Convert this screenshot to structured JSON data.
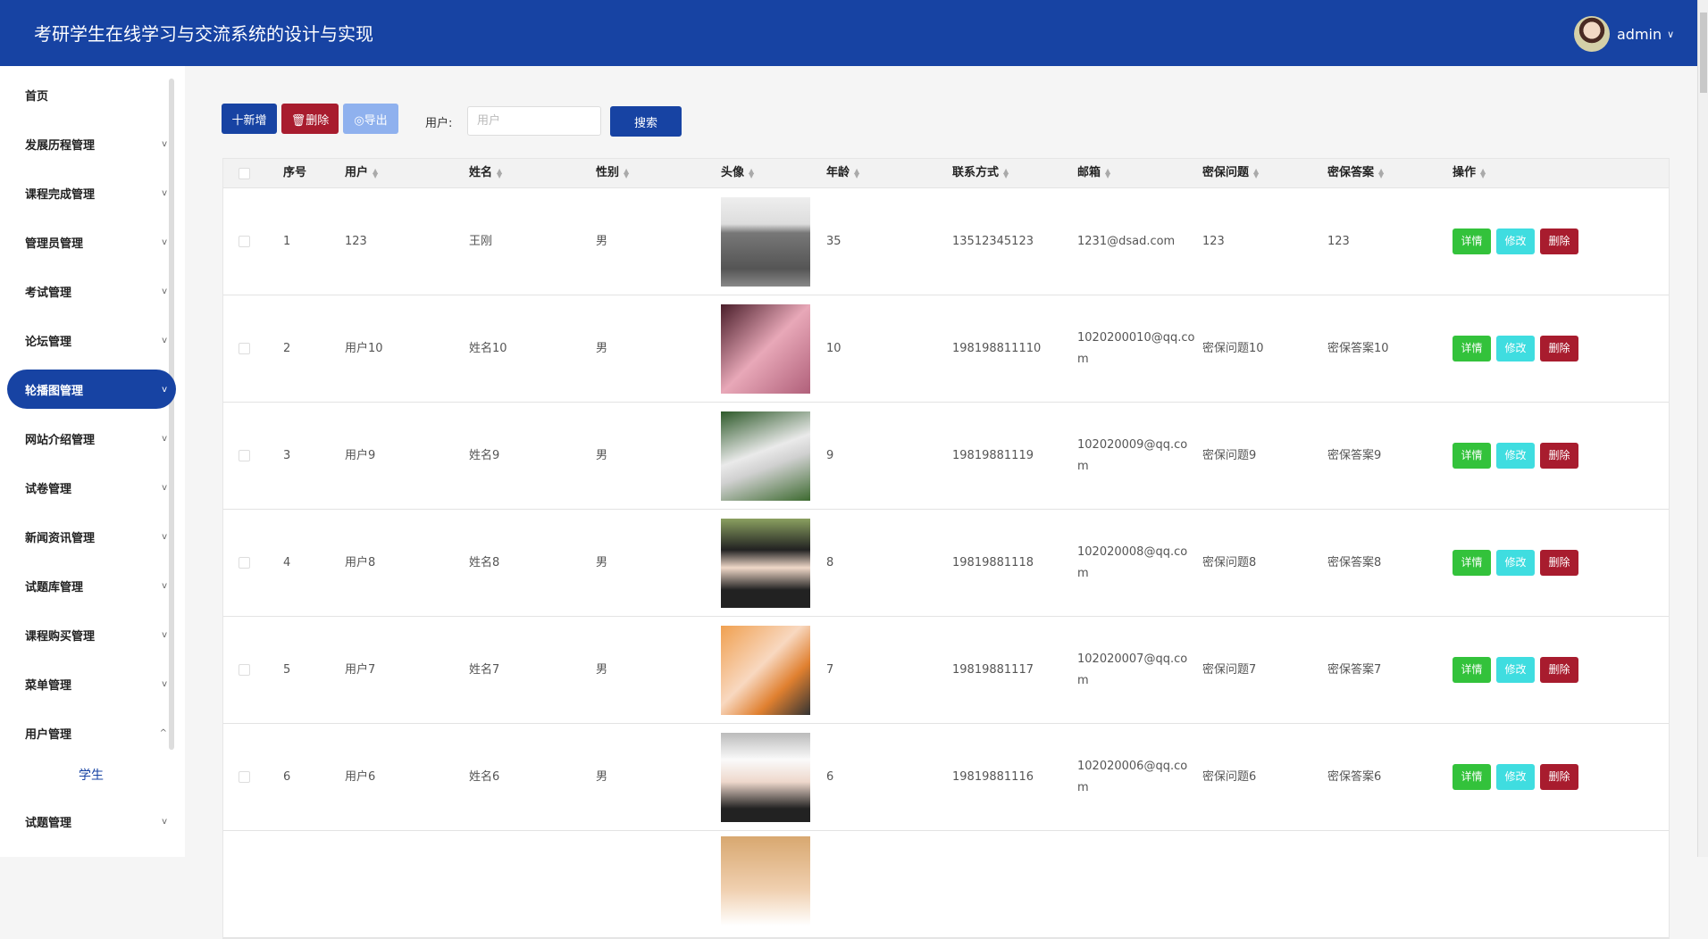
{
  "header": {
    "title": "考研学生在线学习与交流系统的设计与实现",
    "username": "admin"
  },
  "sidebar": {
    "items": [
      {
        "label": "首页",
        "arrow": ""
      },
      {
        "label": "发展历程管理",
        "arrow": "v"
      },
      {
        "label": "课程完成管理",
        "arrow": "v"
      },
      {
        "label": "管理员管理",
        "arrow": "v"
      },
      {
        "label": "考试管理",
        "arrow": "v"
      },
      {
        "label": "论坛管理",
        "arrow": "v"
      },
      {
        "label": "轮播图管理",
        "arrow": "v"
      },
      {
        "label": "网站介绍管理",
        "arrow": "v"
      },
      {
        "label": "试卷管理",
        "arrow": "v"
      },
      {
        "label": "新闻资讯管理",
        "arrow": "v"
      },
      {
        "label": "试题库管理",
        "arrow": "v"
      },
      {
        "label": "课程购买管理",
        "arrow": "v"
      },
      {
        "label": "菜单管理",
        "arrow": "v"
      },
      {
        "label": "用户管理",
        "arrow": "^"
      }
    ],
    "sub_item": "学生",
    "last_item": {
      "label": "试题管理",
      "arrow": "v"
    }
  },
  "toolbar": {
    "add": "十新增",
    "delete": "🗑删除",
    "export": "◎导出",
    "search_label": "用户:",
    "search_placeholder": "用户",
    "search_value": "",
    "search_button": "搜索"
  },
  "colors": {
    "primary": "#1743a3",
    "danger": "#a81c2e",
    "export": "#8fb1ee",
    "detail": "#33c23b",
    "edit": "#3fdde0"
  },
  "table": {
    "headers": [
      "序号",
      "用户",
      "姓名",
      "性别",
      "头像",
      "年龄",
      "联系方式",
      "邮箱",
      "密保问题",
      "密保答案",
      "操作"
    ],
    "actions": {
      "detail": "详情",
      "edit": "修改",
      "delete": "删除"
    },
    "rows": [
      {
        "no": "1",
        "user": "123",
        "name": "王刚",
        "gender": "男",
        "age": "35",
        "phone": "13512345123",
        "email": "1231@dsad.com",
        "question": "123",
        "answer": "123"
      },
      {
        "no": "2",
        "user": "用户10",
        "name": "姓名10",
        "gender": "男",
        "age": "10",
        "phone": "198198811110",
        "email": "1020200010@qq.com",
        "question": "密保问题10",
        "answer": "密保答案10"
      },
      {
        "no": "3",
        "user": "用户9",
        "name": "姓名9",
        "gender": "男",
        "age": "9",
        "phone": "19819881119",
        "email": "102020009@qq.com",
        "question": "密保问题9",
        "answer": "密保答案9"
      },
      {
        "no": "4",
        "user": "用户8",
        "name": "姓名8",
        "gender": "男",
        "age": "8",
        "phone": "19819881118",
        "email": "102020008@qq.com",
        "question": "密保问题8",
        "answer": "密保答案8"
      },
      {
        "no": "5",
        "user": "用户7",
        "name": "姓名7",
        "gender": "男",
        "age": "7",
        "phone": "19819881117",
        "email": "102020007@qq.com",
        "question": "密保问题7",
        "answer": "密保答案7"
      },
      {
        "no": "6",
        "user": "用户6",
        "name": "姓名6",
        "gender": "男",
        "age": "6",
        "phone": "19819881116",
        "email": "102020006@qq.com",
        "question": "密保问题6",
        "answer": "密保答案6"
      }
    ]
  }
}
